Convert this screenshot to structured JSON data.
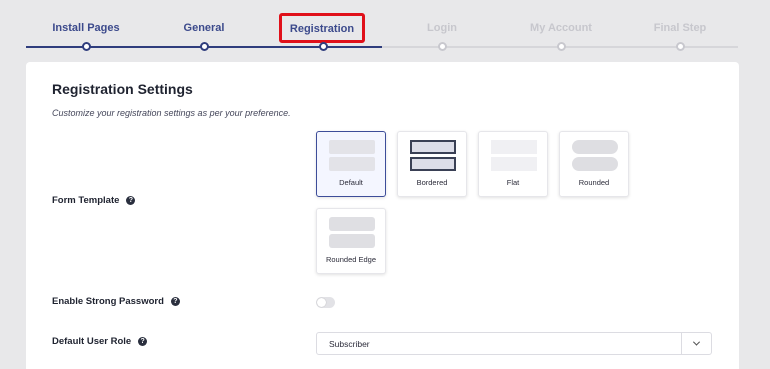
{
  "stepper": {
    "steps": [
      {
        "label": "Install Pages",
        "state": "done"
      },
      {
        "label": "General",
        "state": "done"
      },
      {
        "label": "Registration",
        "state": "active"
      },
      {
        "label": "Login",
        "state": "todo"
      },
      {
        "label": "My Account",
        "state": "todo"
      },
      {
        "label": "Final Step",
        "state": "todo"
      }
    ]
  },
  "card": {
    "title": "Registration Settings",
    "description": "Customize your registration settings as per your preference."
  },
  "form_template": {
    "label": "Form Template",
    "selected": "Default",
    "options": [
      "Default",
      "Bordered",
      "Flat",
      "Rounded",
      "Rounded Edge"
    ]
  },
  "strong_password": {
    "label": "Enable Strong Password",
    "enabled": false
  },
  "user_role": {
    "label": "Default User Role",
    "value": "Subscriber"
  },
  "colors": {
    "accent": "#2f3d7d",
    "highlight": "#e0101a"
  },
  "icons": {
    "help": "help-icon",
    "dropdown": "chevron-down-icon"
  }
}
